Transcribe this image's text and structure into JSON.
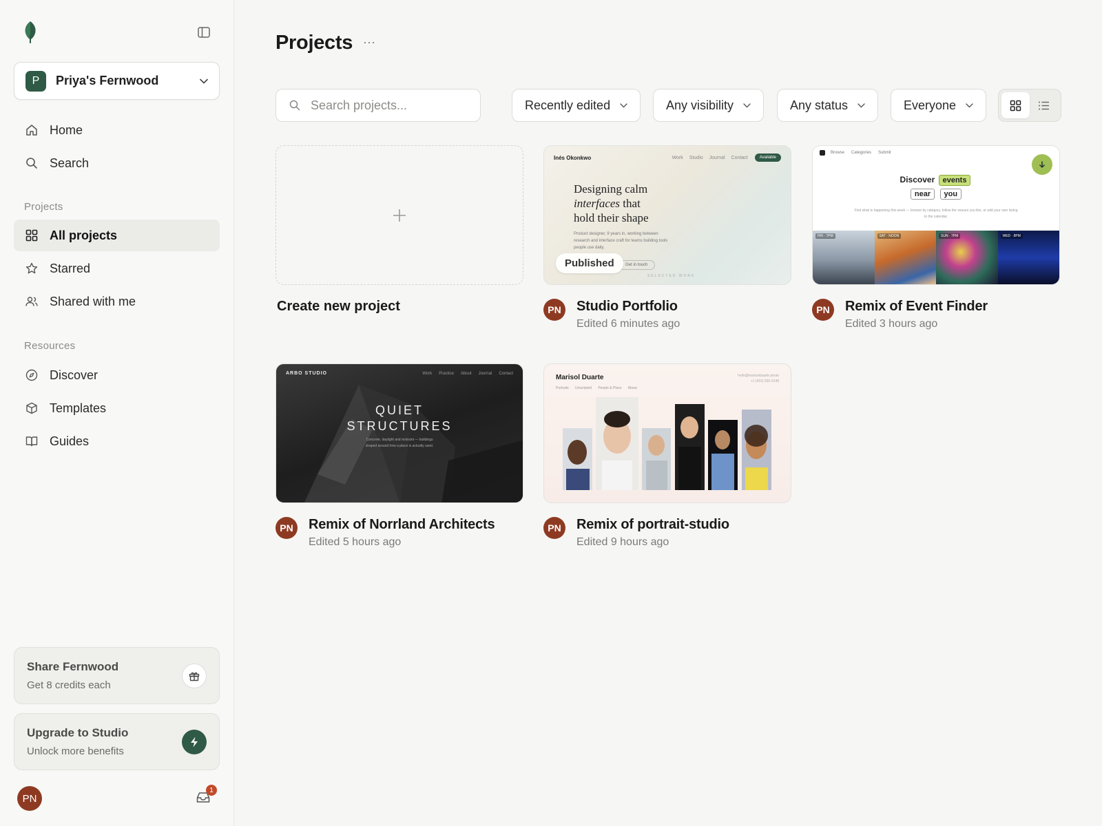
{
  "sidebar": {
    "workspace": {
      "initial": "P",
      "name": "Priya's Fernwood"
    },
    "nav_main": [
      {
        "label": "Home",
        "icon": "home-icon"
      },
      {
        "label": "Search",
        "icon": "search-icon"
      }
    ],
    "projects_label": "Projects",
    "nav_projects": [
      {
        "label": "All projects",
        "icon": "grid-icon",
        "active": true
      },
      {
        "label": "Starred",
        "icon": "star-icon"
      },
      {
        "label": "Shared with me",
        "icon": "users-icon"
      }
    ],
    "resources_label": "Resources",
    "nav_resources": [
      {
        "label": "Discover",
        "icon": "compass-icon"
      },
      {
        "label": "Templates",
        "icon": "box-icon"
      },
      {
        "label": "Guides",
        "icon": "book-icon"
      }
    ],
    "promo_share": {
      "title": "Share Fernwood",
      "subtitle": "Get 8 credits each",
      "icon": "gift-icon"
    },
    "promo_upgrade": {
      "title": "Upgrade to Studio",
      "subtitle": "Unlock more benefits",
      "icon": "bolt-icon"
    },
    "user_initials": "PN",
    "inbox_count": "1"
  },
  "main": {
    "title": "Projects",
    "more_label": "···",
    "search_placeholder": "Search projects...",
    "filters": [
      {
        "label": "Recently edited"
      },
      {
        "label": "Any visibility"
      },
      {
        "label": "Any status"
      },
      {
        "label": "Everyone"
      }
    ],
    "create_label": "Create new project",
    "projects": [
      {
        "title": "Studio Portfolio",
        "edited": "Edited 6 minutes ago",
        "initials": "PN"
      },
      {
        "title": "Remix of Event Finder",
        "edited": "Edited 3 hours ago",
        "initials": "PN"
      },
      {
        "title": "Remix of Norrland Architects",
        "edited": "Edited 5 hours ago",
        "initials": "PN"
      },
      {
        "title": "Remix of portrait-studio",
        "edited": "Edited 9 hours ago",
        "initials": "PN"
      }
    ]
  },
  "thumbs": {
    "portfolio": {
      "brand": "Inés Okonkwo",
      "links": [
        "Work",
        "Studio",
        "Journal",
        "Contact"
      ],
      "pill": "Available",
      "line1": "Designing calm",
      "line2_italic": "interfaces",
      "line2_rest": " that",
      "line3": "hold their shape",
      "desc": "Product designer, 9 years in, working between research and interface craft for teams building tools people use daily.",
      "badge": "Published",
      "cta": "Get in touch",
      "selected": "SELECTED WORK"
    },
    "events": {
      "links": [
        "Browse",
        "Categories",
        "Submit"
      ],
      "discover": "Discover",
      "tag1": "events",
      "tag2": "near",
      "tag3": "you",
      "desc": "Find what is happening this week — browse by category, follow the venues you like, or add your own listing to the calendar.",
      "strip_labels": [
        "FRI · 7PM",
        "SAT · NOON",
        "SUN · 7PM",
        "WED · 8PM"
      ]
    },
    "norrland": {
      "brand": "ARBO STUDIO",
      "links": [
        "Work",
        "Practice",
        "About",
        "Journal",
        "Contact"
      ],
      "line1": "QUIET",
      "line2": "STRUCTURES",
      "desc1": "Concrete, daylight and restraint — buildings",
      "desc2": "shaped around how a place is actually used."
    },
    "portrait": {
      "name": "Marisol Duarte",
      "links": [
        "Portraits",
        "Unscripted",
        "People & Place",
        "About"
      ],
      "email": "hello@marisolduarte.photo",
      "phone": "+1 (415) 555-0148"
    }
  },
  "colors": {
    "brand_green": "#2f5a46",
    "avatar_rust": "#8e3a22",
    "badge_red": "#c24a2a"
  }
}
